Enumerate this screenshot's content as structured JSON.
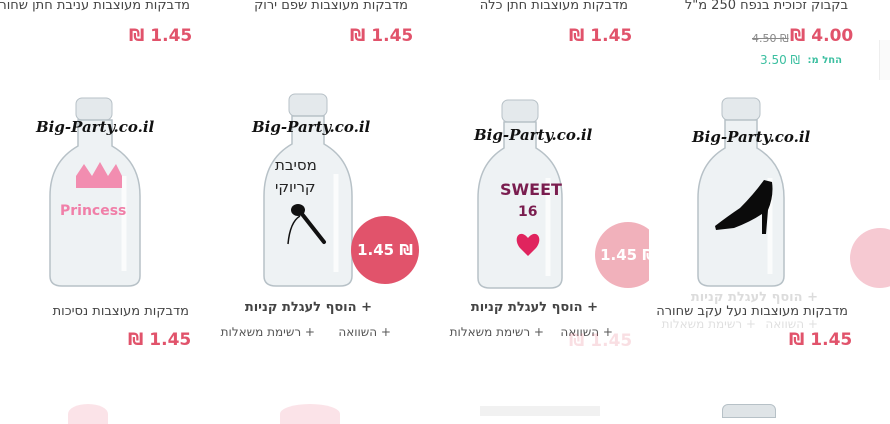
{
  "top_row": {
    "p1": {
      "title": "מדבקות מעוצבות עניבת חתן שחורה",
      "price": "1.45 ₪"
    },
    "p2": {
      "title": "מדבקות מעוצבות שפם ירוק",
      "price": "1.45 ₪"
    },
    "p3": {
      "title": "מדבקות מעוצבות חתן כלה",
      "price": "1.45 ₪"
    },
    "p4": {
      "title": "בקבוק זכוכית בנפח 250 מ\"ל",
      "price": "4.00 ₪",
      "old_price": "4.50 ₪",
      "from_label": "החל מ:",
      "from_price": "3.50 ₪"
    }
  },
  "products": [
    {
      "brand": "Big-Party.co.il",
      "art": "Princess",
      "title": "מדבקות מעוצבות נסיכות",
      "price": "1.45 ₪"
    },
    {
      "brand": "Big-Party.co.il",
      "art_line1": "מסיבת",
      "art_line2": "קריוקי",
      "badge": "1.45 ₪",
      "add_cart": "+ הוסף לעגלת קניות",
      "compare": "+ השוואה",
      "wishlist": "+ רשימת משאלות"
    },
    {
      "brand": "Big-Party.co.il",
      "art_line1": "SWEET",
      "art_line2": "16",
      "badge": "1.45 ₪",
      "add_cart": "+ הוסף לעגלת קניות",
      "compare": "+ השוואה",
      "wishlist": "+ רשימת משאלות",
      "price": "1.45 ₪"
    },
    {
      "brand": "Big-Party.co.il",
      "title": "מדבקות מעוצבות נעל עקב שחורה",
      "price": "1.45 ₪",
      "add_cart": "+ הוסף לעגלת קניות",
      "compare": "+ השוואה",
      "wishlist": "+ רשימת משאלות"
    }
  ],
  "colors": {
    "accent": "#e1536b",
    "teal": "#3bbfa0"
  }
}
